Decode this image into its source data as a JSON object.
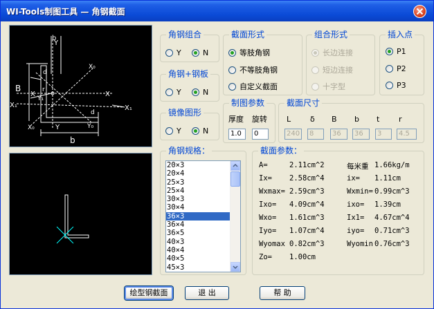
{
  "window": {
    "title": "WI-Tools制图工具 — 角钢截面"
  },
  "preview": {
    "labels": {
      "b1": "b",
      "b2": "B",
      "b3": "b",
      "d1": "d",
      "d2": "d",
      "x1": "X",
      "x2": "X",
      "x1b": "X₁",
      "x1c": "X₁",
      "y1": "Y",
      "y2": "Y",
      "x0a": "X₀",
      "x0b": "X₀",
      "y0": "Y₀",
      "y1b": "Y₁",
      "r": "r"
    }
  },
  "groups": {
    "angle_combo": {
      "title": "角钢组合",
      "options": [
        "Y",
        "N"
      ],
      "selected": "N"
    },
    "angle_plate": {
      "title": "角钢+钢板",
      "options": [
        "Y",
        "N"
      ],
      "selected": "N"
    },
    "mirror": {
      "title": "镜像图形",
      "options": [
        "Y",
        "N"
      ],
      "selected": "N"
    },
    "section_form": {
      "title": "截面形式",
      "options": [
        "等肢角钢",
        "不等肢角钢",
        "自定义截面"
      ],
      "selected": "等肢角钢"
    },
    "combo_form": {
      "title": "组合形式",
      "options": [
        "长边连接",
        "短边连接",
        "十字型"
      ],
      "selected": "长边连接"
    },
    "insert_point": {
      "title": "插入点",
      "options": [
        "P1",
        "P2",
        "P3"
      ],
      "selected": "P1"
    },
    "draw_params": {
      "title": "制图参数",
      "thickness_label": "厚度",
      "rotate_label": "旋转",
      "thickness": "1.0",
      "rotate": "0"
    },
    "section_size": {
      "title": "截面尺寸",
      "headers": [
        "L",
        "δ",
        "B",
        "b",
        "t",
        "r"
      ],
      "values": [
        "240",
        "8",
        "36",
        "36",
        "3",
        "4.5"
      ]
    },
    "spec": {
      "title": "角钢规格：",
      "items": [
        "20×3",
        "20×4",
        "25×3",
        "25×4",
        "30×3",
        "30×4",
        "36×3",
        "36×4",
        "36×5",
        "40×3",
        "40×4",
        "40×5",
        "45×3"
      ],
      "selected": "36×3"
    },
    "section_params": {
      "title": "截面参数：",
      "rows": [
        [
          "A=",
          "2.11cm^2",
          "每米重",
          "1.66kg/m"
        ],
        [
          "Ix=",
          "2.58cm^4",
          "ix=",
          "1.11cm"
        ],
        [
          "Wxmax=",
          "2.59cm^3",
          "Wxmin=",
          "0.99cm^3"
        ],
        [
          "Ixo=",
          "4.09cm^4",
          "ixo=",
          "1.39cm"
        ],
        [
          "Wxo=",
          "1.61cm^3",
          "Ix1=",
          "4.67cm^4"
        ],
        [
          "Iyo=",
          "1.07cm^4",
          "iyo=",
          "0.71cm^3"
        ],
        [
          "Wyomax",
          "0.82cm^3",
          "Wyomin",
          "0.76cm^3"
        ],
        [
          "Zo=",
          "1.00cm",
          "",
          ""
        ]
      ]
    }
  },
  "buttons": {
    "draw": "绘型钢截面",
    "exit": "退 出",
    "help": "帮 助"
  },
  "colors": {
    "title_bar": "#0a4ad6",
    "group_title": "#0046d5",
    "list_selection": "#316ac5",
    "preview_line": "#ffffff",
    "preview_axis": "#00ffff"
  }
}
